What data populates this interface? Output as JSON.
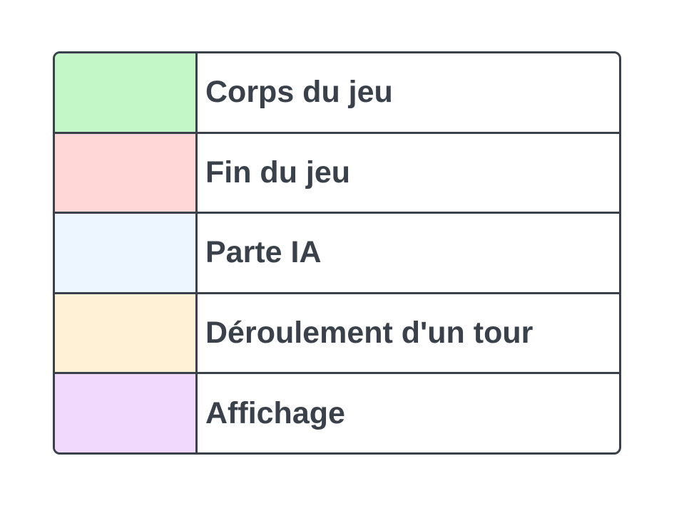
{
  "legend": {
    "items": [
      {
        "label": "Corps du jeu",
        "color": "#c3f7c8"
      },
      {
        "label": "Fin du jeu",
        "color": "#ffd7d7"
      },
      {
        "label": "Parte IA",
        "color": "#edf5ff"
      },
      {
        "label": "Déroulement d'un tour",
        "color": "#fff1d6"
      },
      {
        "label": "Affichage",
        "color": "#f1d9fe"
      }
    ]
  }
}
